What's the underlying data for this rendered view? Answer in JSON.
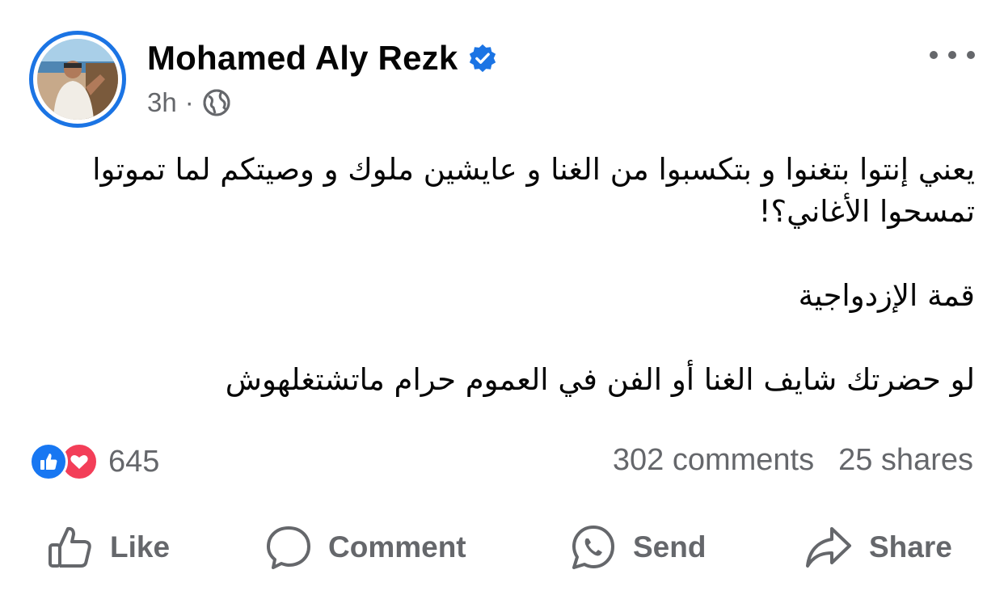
{
  "post": {
    "author": "Mohamed Aly Rezk",
    "time": "3h",
    "separator": "·",
    "privacy_icon": "globe-icon",
    "verified_icon": "verified-badge-icon",
    "paragraphs": [
      "يعني إنتوا بتغنوا و بتكسبوا من الغنا و عايشين ملوك و وصيتكم لما تموتوا تمسحوا الأغاني؟!",
      "قمة الإزدواجية",
      "لو حضرتك شايف الغنا أو الفن في العموم حرام ماتشتغلهوش"
    ]
  },
  "reactions": {
    "count": "645",
    "icons": [
      "like-icon",
      "love-icon"
    ],
    "colors": {
      "like": "#1877f2",
      "love": "#f33e58"
    }
  },
  "stats": {
    "comments": "302 comments",
    "shares": "25 shares"
  },
  "actions": {
    "like": "Like",
    "comment": "Comment",
    "send": "Send",
    "share": "Share"
  },
  "colors": {
    "accent": "#1b74e4",
    "secondary_text": "#65676b"
  }
}
